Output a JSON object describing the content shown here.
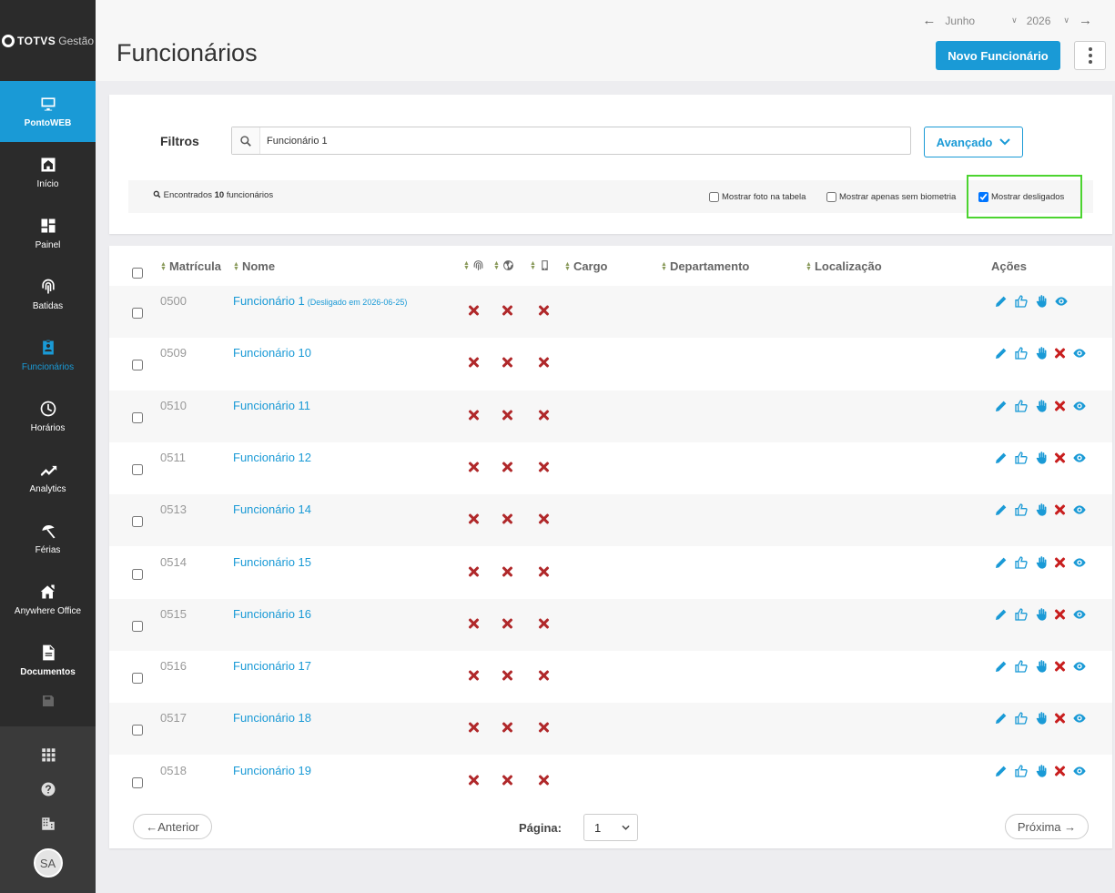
{
  "app": {
    "logo_brand": "TOTVS",
    "logo_suffix": "Gestão"
  },
  "sidebar": {
    "top_item": {
      "label": "PontoWEB",
      "icon": "monitor-icon"
    },
    "items": [
      {
        "label": "Início",
        "icon": "home-icon"
      },
      {
        "label": "Painel",
        "icon": "dashboard-icon"
      },
      {
        "label": "Batidas",
        "icon": "fingerprint-icon"
      },
      {
        "label": "Funcionários",
        "icon": "badge-icon",
        "active": true
      },
      {
        "label": "Horários",
        "icon": "clock-icon"
      },
      {
        "label": "Analytics",
        "icon": "trend-icon"
      },
      {
        "label": "Férias",
        "icon": "umbrella-icon"
      },
      {
        "label": "Anywhere Office",
        "icon": "house-icon"
      },
      {
        "label": "Documentos",
        "icon": "document-icon"
      }
    ],
    "bottom": {
      "icons": [
        "apps-grid-icon",
        "help-icon",
        "building-icon"
      ],
      "avatar_initials": "SA"
    }
  },
  "header": {
    "month": "Junho",
    "year": "2026",
    "title": "Funcionários",
    "new_button": "Novo Funcionário"
  },
  "filters": {
    "label": "Filtros",
    "search_value": "Funcionário 1",
    "advanced_button": "Avançado",
    "found_prefix": "Encontrados",
    "found_count": "10",
    "found_suffix": "funcionários",
    "options": [
      {
        "label": "Mostrar foto na tabela",
        "checked": false
      },
      {
        "label": "Mostrar apenas sem biometria",
        "checked": false
      },
      {
        "label": "Mostrar desligados",
        "checked": true
      }
    ]
  },
  "table": {
    "columns": {
      "matricula": "Matrícula",
      "nome": "Nome",
      "cargo": "Cargo",
      "departamento": "Departamento",
      "localizacao": "Localização",
      "acoes": "Ações"
    },
    "column_icons": [
      "fingerprint-icon",
      "globe-icon",
      "mobile-icon"
    ],
    "rows": [
      {
        "matricula": "0500",
        "nome": "Funcionário 1",
        "note": "(Desligado em 2026-06-25)",
        "dismissed": true
      },
      {
        "matricula": "0509",
        "nome": "Funcionário 10",
        "note": "",
        "dismissed": false
      },
      {
        "matricula": "0510",
        "nome": "Funcionário 11",
        "note": "",
        "dismissed": false
      },
      {
        "matricula": "0511",
        "nome": "Funcionário 12",
        "note": "",
        "dismissed": false
      },
      {
        "matricula": "0513",
        "nome": "Funcionário 14",
        "note": "",
        "dismissed": false
      },
      {
        "matricula": "0514",
        "nome": "Funcionário 15",
        "note": "",
        "dismissed": false
      },
      {
        "matricula": "0515",
        "nome": "Funcionário 16",
        "note": "",
        "dismissed": false
      },
      {
        "matricula": "0516",
        "nome": "Funcionário 17",
        "note": "",
        "dismissed": false
      },
      {
        "matricula": "0517",
        "nome": "Funcionário 18",
        "note": "",
        "dismissed": false
      },
      {
        "matricula": "0518",
        "nome": "Funcionário 19",
        "note": "",
        "dismissed": false
      }
    ]
  },
  "pagination": {
    "prev": "←Anterior",
    "page_label": "Página:",
    "page_value": "1",
    "next": "Próxima →"
  },
  "colors": {
    "accent": "#1a9ad6",
    "sidebar_bg": "#2b2b2b",
    "error_x": "#b0282a",
    "highlight": "#4cd430"
  }
}
